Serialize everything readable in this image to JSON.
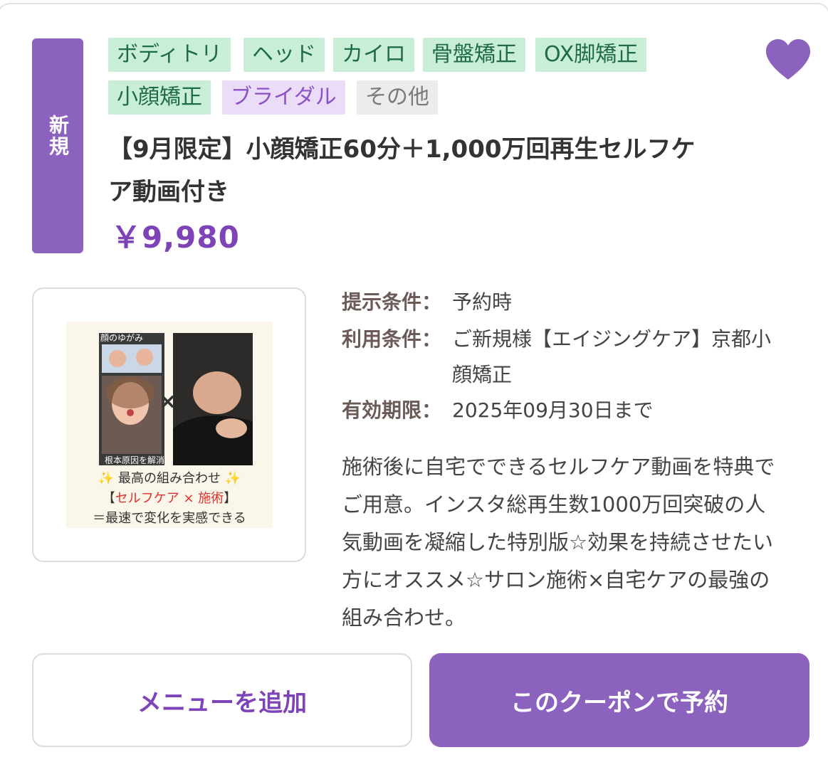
{
  "coupon": {
    "new_badge": "新規",
    "tags": [
      {
        "label": "ボディトリ",
        "style": "green"
      },
      {
        "label": "ヘッド",
        "style": "green"
      },
      {
        "label": "カイロ",
        "style": "green"
      },
      {
        "label": "骨盤矯正",
        "style": "green"
      },
      {
        "label": "OX脚矯正",
        "style": "green"
      },
      {
        "label": "小顔矯正",
        "style": "green"
      },
      {
        "label": "ブライダル",
        "style": "purple"
      },
      {
        "label": "その他",
        "style": "gray"
      }
    ],
    "title_line1": "【9月限定】小顔矯正60分＋1,000万回再生セルフケ",
    "title_line2": "ア動画付き",
    "price": "￥9,980",
    "favorite_icon": "heart-icon",
    "image": {
      "caption_top": "顔のゆがみ",
      "caption_bottom": "根本原因を解消",
      "line1": "✨ 最高の組み合わせ ✨",
      "line2_prefix": "【",
      "line2_red": "セルフケア × 施術",
      "line2_suffix": "】",
      "line3": "＝最速で変化を実感できる"
    },
    "conditions": [
      {
        "label": "提示条件：",
        "value_lines": [
          "予約時"
        ]
      },
      {
        "label": "利用条件：",
        "value_lines": [
          "ご新規様【エイジングケア】京都小",
          "顔矯正"
        ]
      },
      {
        "label": "有効期限：",
        "value_lines": [
          "2025年09月30日まで"
        ]
      }
    ],
    "description_lines": [
      "施術後に自宅でできるセルフケア動画を特典で",
      "ご用意。インスタ総再生数1000万回突破の人",
      "気動画を凝縮した特別版☆効果を持続させたい",
      "方にオススメ☆サロン施術×自宅ケアの最強の",
      "組み合わせ。"
    ],
    "buttons": {
      "add_menu": "メニューを追加",
      "reserve": "このクーポンで予約"
    }
  },
  "colors": {
    "accent": "#8c62bf",
    "price": "#7e43b8",
    "tag_green_bg": "#c9eed7",
    "tag_purple_bg": "#ebdcf7",
    "tag_gray_bg": "#ececec",
    "red_text": "#e0302a"
  }
}
